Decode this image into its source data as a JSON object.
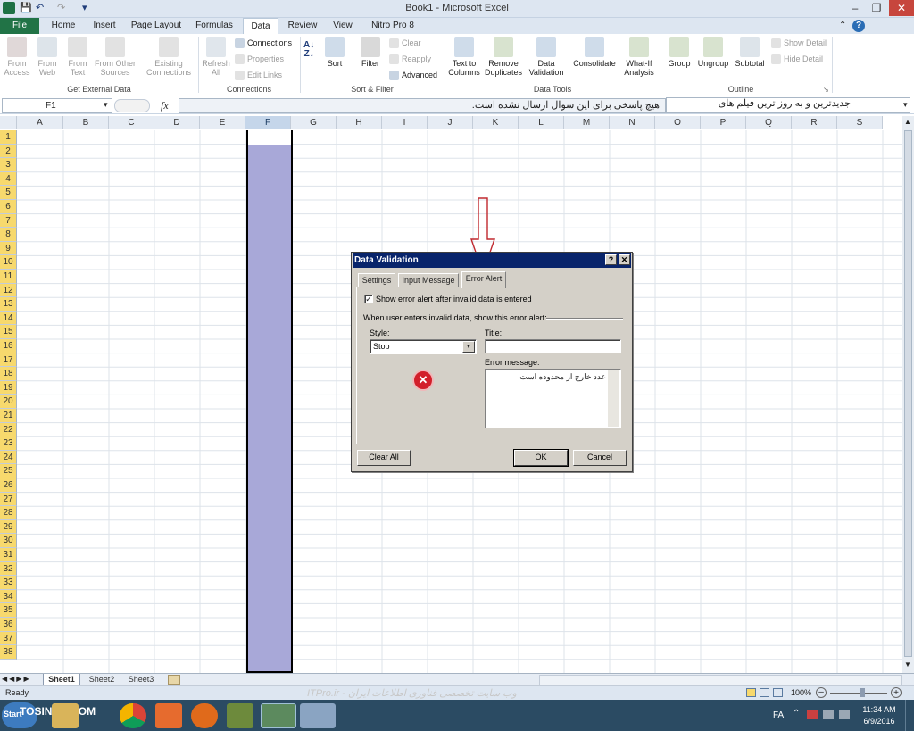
{
  "window": {
    "title": "Book1 - Microsoft Excel"
  },
  "tabs": [
    "File",
    "Home",
    "Insert",
    "Page Layout",
    "Formulas",
    "Data",
    "Review",
    "View",
    "Nitro Pro 8"
  ],
  "ribbon": {
    "get_external": {
      "label": "Get External Data",
      "from_access": "From Access",
      "from_web": "From Web",
      "from_text": "From Text",
      "from_other": "From Other Sources",
      "existing": "Existing Connections"
    },
    "connections": {
      "label": "Connections",
      "refresh": "Refresh All",
      "connections": "Connections",
      "properties": "Properties",
      "edit_links": "Edit Links"
    },
    "sort_filter": {
      "label": "Sort & Filter",
      "sort": "Sort",
      "filter": "Filter",
      "clear": "Clear",
      "reapply": "Reapply",
      "advanced": "Advanced"
    },
    "data_tools": {
      "label": "Data Tools",
      "text_to_columns": "Text to Columns",
      "remove_duplicates": "Remove Duplicates",
      "data_validation": "Data Validation",
      "consolidate": "Consolidate",
      "what_if": "What-If Analysis"
    },
    "outline": {
      "label": "Outline",
      "group": "Group",
      "ungroup": "Ungroup",
      "subtotal": "Subtotal",
      "show_detail": "Show Detail",
      "hide_detail": "Hide Detail"
    }
  },
  "formula_bar": {
    "name_box": "F1",
    "fx": "fx",
    "value": "هیچ پاسخی برای این سوال ارسال نشده است.",
    "value2": "جدیدترین و به روز ترین فیلم های"
  },
  "columns": [
    "A",
    "B",
    "C",
    "D",
    "E",
    "F",
    "G",
    "H",
    "I",
    "J",
    "K",
    "L",
    "M",
    "N",
    "O",
    "P",
    "Q",
    "R",
    "S"
  ],
  "rows": [
    "1",
    "2",
    "3",
    "4",
    "5",
    "6",
    "7",
    "8",
    "9",
    "10",
    "11",
    "12",
    "13",
    "14",
    "15",
    "16",
    "17",
    "18",
    "19",
    "20",
    "21",
    "22",
    "23",
    "24",
    "25",
    "26",
    "27",
    "28",
    "29",
    "30",
    "31",
    "32",
    "33",
    "34",
    "35",
    "36",
    "37",
    "38"
  ],
  "dialog": {
    "title": "Data Validation",
    "tabs": [
      "Settings",
      "Input Message",
      "Error Alert"
    ],
    "show_alert": "Show error alert after invalid data is entered",
    "when_label": "When user enters invalid data, show this error alert:",
    "style_label": "Style:",
    "style_value": "Stop",
    "title_label": "Title:",
    "title_value": "",
    "message_label": "Error message:",
    "message_value": "عدد خارج از محدوده است",
    "clear_all": "Clear All",
    "ok": "OK",
    "cancel": "Cancel"
  },
  "sheets": [
    "Sheet1",
    "Sheet2",
    "Sheet3"
  ],
  "status": {
    "ready": "Ready",
    "watermark": "ITPro.ir - وب سایت تخصصی فناوری اطلاعات ایران",
    "zoom": "100%"
  },
  "taskbar": {
    "start": "Start",
    "watermark": "TOSINSO.COM",
    "lang": "FA",
    "time": "11:34 AM",
    "date": "6/9/2016"
  }
}
